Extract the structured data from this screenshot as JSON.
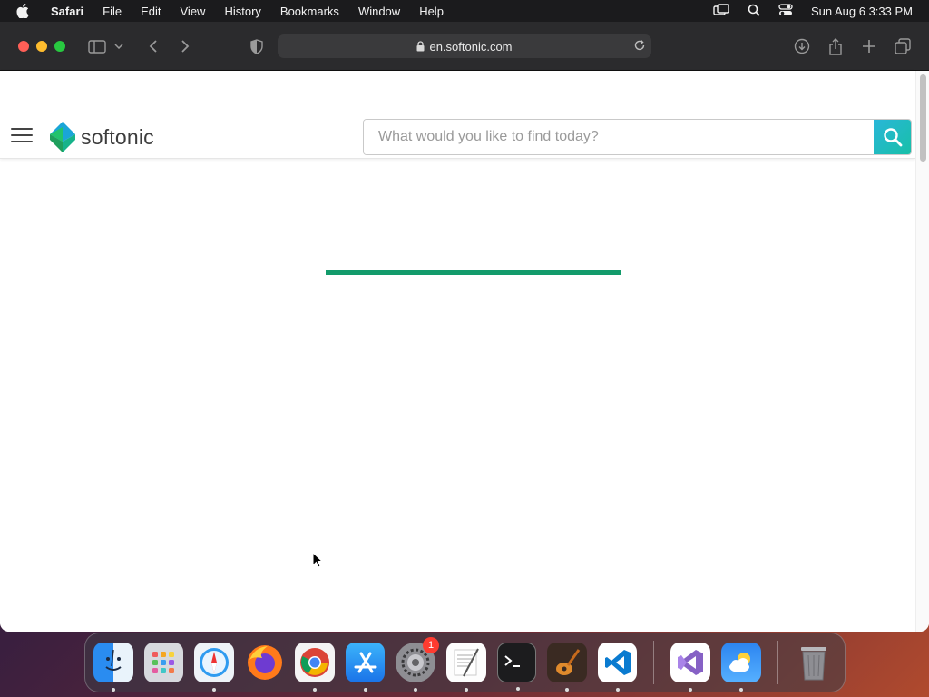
{
  "menubar": {
    "app_name": "Safari",
    "items": [
      "File",
      "Edit",
      "View",
      "History",
      "Bookmarks",
      "Window",
      "Help"
    ],
    "clock": "Sun Aug 6  3:33 PM"
  },
  "browser": {
    "url": "en.softonic.com"
  },
  "site": {
    "logo_text": "softonic",
    "search_placeholder": "What would you like to find today?"
  },
  "loader": {
    "progress": 1.0,
    "color": "#139b6b"
  },
  "dock": {
    "apps": [
      "finder",
      "launchpad",
      "safari",
      "firefox",
      "chrome",
      "app-store",
      "system-settings",
      "textedit",
      "terminal",
      "garageband",
      "vscode",
      "visual-studio",
      "weather",
      "trash"
    ],
    "system_settings_badge": "1"
  },
  "colors": {
    "brand_green": "#139b6b",
    "search_button": "#22bcc4"
  }
}
